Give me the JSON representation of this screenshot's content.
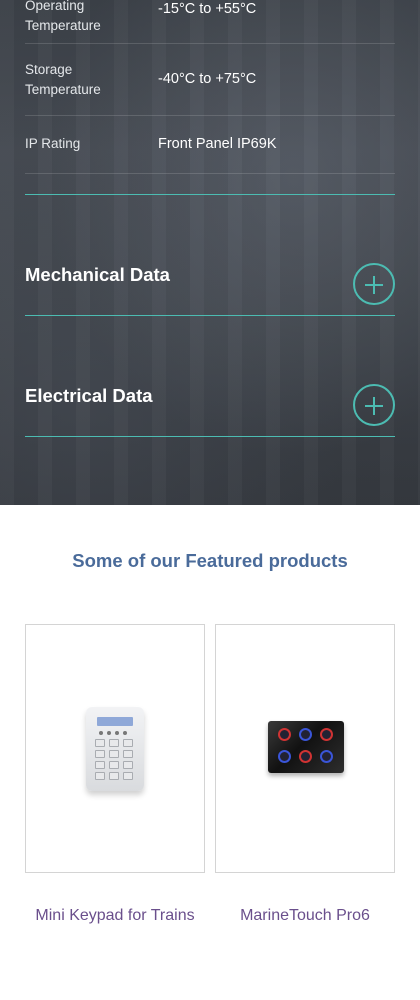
{
  "specs": [
    {
      "label": "Operating Temperature",
      "value": "-15°C to +55°C"
    },
    {
      "label": "Storage Temperature",
      "value": "-40°C to +75°C"
    },
    {
      "label": "IP Rating",
      "value": "Front Panel IP69K"
    }
  ],
  "accordions": [
    {
      "title": "Mechanical Data"
    },
    {
      "title": "Electrical Data"
    }
  ],
  "featured": {
    "title": "Some of our Featured products",
    "products": [
      {
        "name": "Mini Keypad for Trains",
        "image": "keypad-image"
      },
      {
        "name": "MarineTouch Pro6",
        "image": "marinetouch-image"
      }
    ]
  },
  "colors": {
    "accent_teal": "#4cbcb2",
    "heading_blue": "#4a6b9a",
    "product_purple": "#6a4f8c"
  }
}
